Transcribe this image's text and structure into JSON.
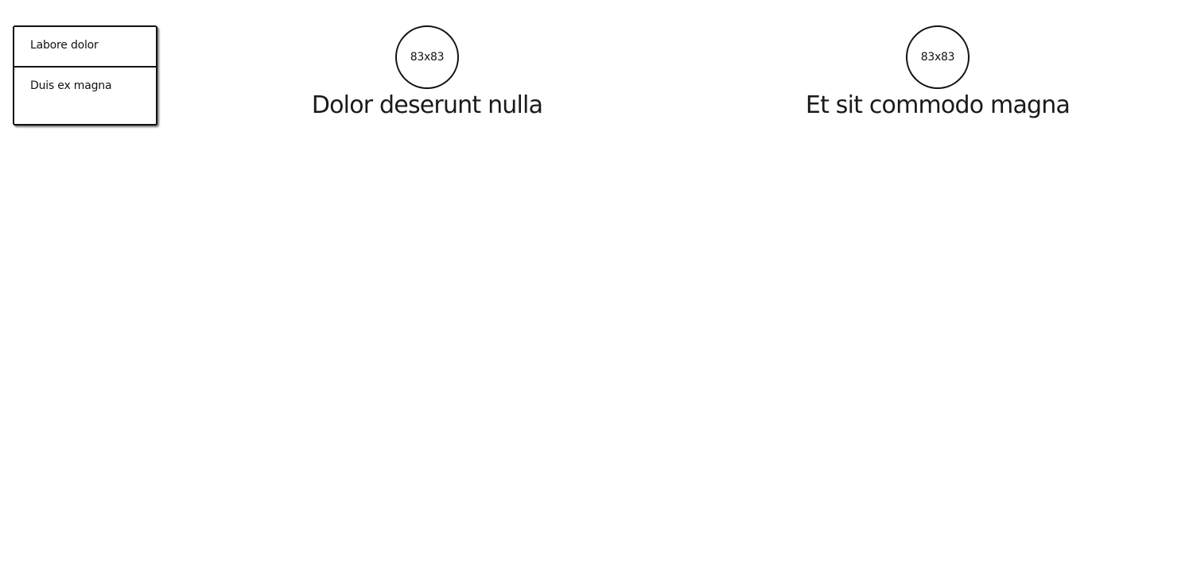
{
  "menu": {
    "items": [
      {
        "label": "Labore dolor"
      },
      {
        "label": "Duis ex magna"
      }
    ]
  },
  "cards": [
    {
      "avatar_text": "83x83",
      "title": "Dolor deserunt nulla"
    },
    {
      "avatar_text": "83x83",
      "title": "Et sit commodo magna"
    }
  ]
}
